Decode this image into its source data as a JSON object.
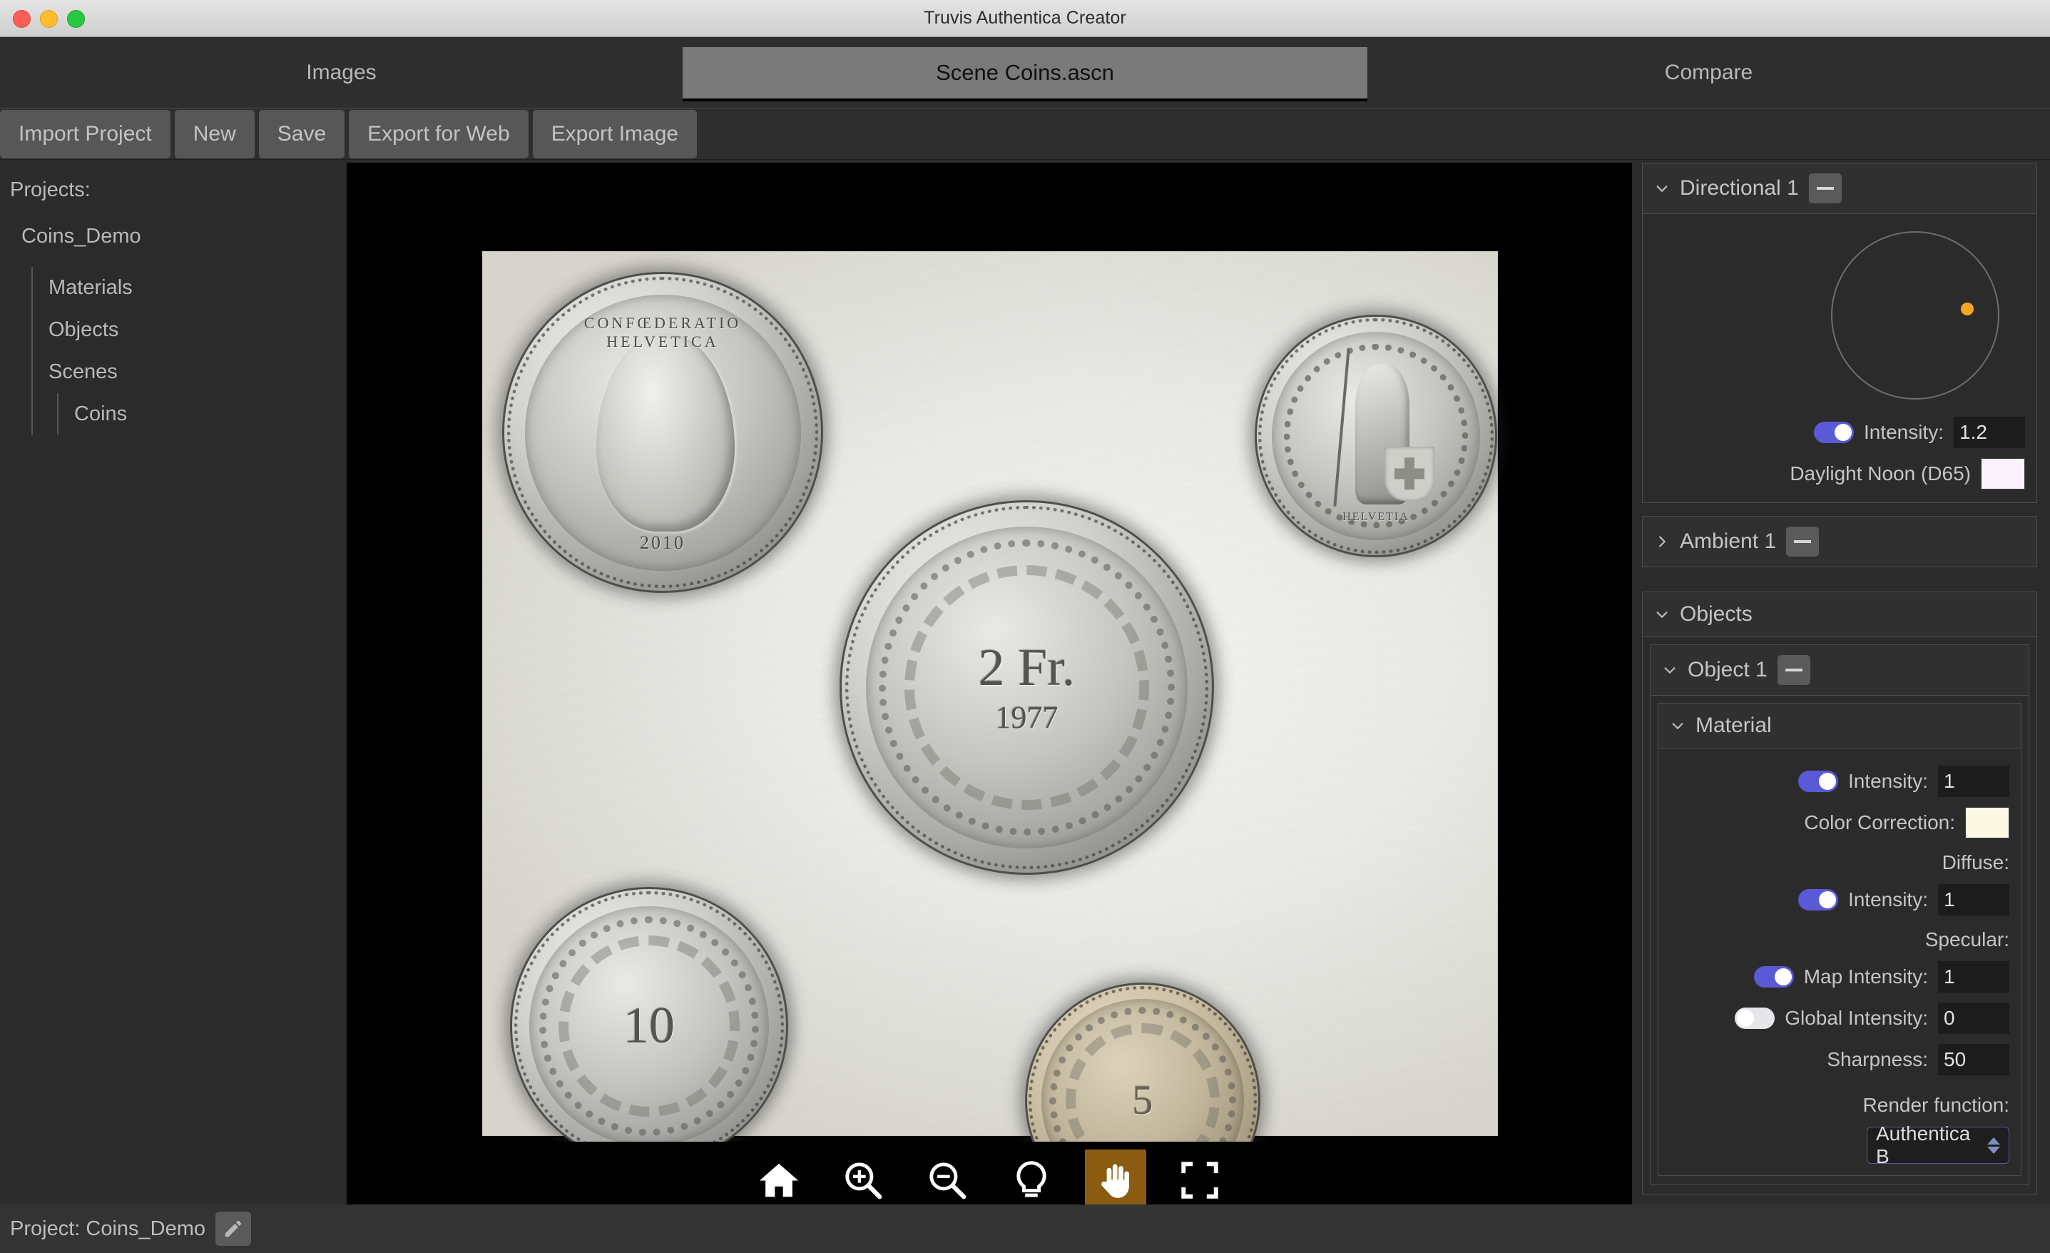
{
  "window": {
    "title": "Truvis Authentica Creator",
    "traffic_lights": [
      "close",
      "minimize",
      "zoom"
    ]
  },
  "tabs": [
    {
      "label": "Images",
      "active": false
    },
    {
      "label": "Scene Coins.ascn",
      "active": true
    },
    {
      "label": "Compare",
      "active": false
    }
  ],
  "toolbar": {
    "import_project": "Import Project",
    "new": "New",
    "save": "Save",
    "export_for_web": "Export for Web",
    "export_image": "Export Image"
  },
  "sidebar": {
    "heading": "Projects:",
    "project": "Coins_Demo",
    "items": [
      {
        "label": "Materials"
      },
      {
        "label": "Objects"
      },
      {
        "label": "Scenes"
      }
    ],
    "scene_children": [
      {
        "label": "Coins"
      }
    ]
  },
  "viewport": {
    "background": "#000000",
    "tools": [
      {
        "name": "home-icon",
        "label": "Home",
        "active": false
      },
      {
        "name": "zoom-in-icon",
        "label": "Zoom In",
        "active": false
      },
      {
        "name": "zoom-out-icon",
        "label": "Zoom Out",
        "active": false
      },
      {
        "name": "lightbulb-icon",
        "label": "Relight",
        "active": false
      },
      {
        "name": "pan-hand-icon",
        "label": "Pan",
        "active": true
      },
      {
        "name": "fullscreen-icon",
        "label": "Fit to Screen",
        "active": false
      }
    ],
    "active_tool_color": "#8a5b10",
    "image_subjects": [
      {
        "name": "10 Rappen obverse",
        "legend": "CONFŒDERATIO HELVETICA",
        "year": "2010"
      },
      {
        "name": "2 Franc reverse",
        "denomination": "2 Fr.",
        "year": "1977"
      },
      {
        "name": "Half Franc reverse",
        "legend": "HELVETIA"
      },
      {
        "name": "10 Rappen reverse",
        "denomination": "10"
      },
      {
        "name": "5 Rappen reverse",
        "denomination": "5"
      }
    ]
  },
  "inspector": {
    "directional": {
      "title": "Directional 1",
      "expanded": true,
      "intensity_label": "Intensity:",
      "intensity_value": "1.2",
      "intensity_on": true,
      "color_label": "Daylight Noon (D65)",
      "color_value": "#fbf3fb",
      "light_dot_color": "#f5a623"
    },
    "ambient": {
      "title": "Ambient 1",
      "expanded": false
    },
    "objects": {
      "title": "Objects",
      "expanded": true,
      "object": {
        "title": "Object 1",
        "expanded": true,
        "material": {
          "title": "Material",
          "expanded": true,
          "intensity_label": "Intensity:",
          "intensity_value": "1",
          "intensity_on": true,
          "color_correction_label": "Color Correction:",
          "color_correction_value": "#fdf8e3",
          "diffuse_label": "Diffuse:",
          "diffuse_intensity_label": "Intensity:",
          "diffuse_intensity_value": "1",
          "diffuse_intensity_on": true,
          "specular_label": "Specular:",
          "map_intensity_label": "Map Intensity:",
          "map_intensity_value": "1",
          "map_intensity_on": true,
          "global_intensity_label": "Global Intensity:",
          "global_intensity_value": "0",
          "global_intensity_on": false,
          "sharpness_label": "Sharpness:",
          "sharpness_value": "50",
          "render_function_label": "Render function:",
          "render_function_value": "Authentica B"
        }
      }
    }
  },
  "statusbar": {
    "text": "Project: Coins_Demo",
    "edit_icon": "pencil-icon"
  },
  "colors": {
    "accent_toggle_on": "#5a5ad6",
    "toggle_off": "#e6e6ea",
    "panel_bg": "#2b2b2b",
    "button_bg": "#575757",
    "active_tab_bg": "#7a7a7a"
  }
}
